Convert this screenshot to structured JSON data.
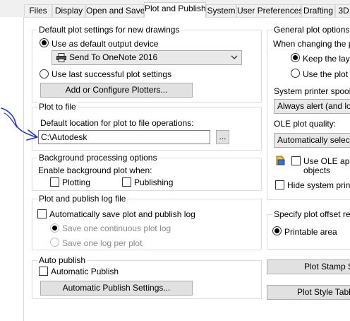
{
  "tabs": [
    "Files",
    "Display",
    "Open and Save",
    "Plot and Publish",
    "System",
    "User Preferences",
    "Drafting",
    "3D"
  ],
  "left": {
    "default_plot": {
      "title": "Default plot settings for new drawings",
      "use_default_device": "Use as default output device",
      "device_value": "Send To OneNote 2016",
      "use_last_successful": "Use last successful plot settings",
      "add_configure_plotters": "Add or Configure Plotters..."
    },
    "plot_to_file": {
      "title": "Plot to file",
      "location_label": "Default location for plot to file operations:",
      "location_value": "C:\\Autodesk",
      "browse_label": "..."
    },
    "background": {
      "title": "Background processing options",
      "enable_label": "Enable background plot when:",
      "plotting": "Plotting",
      "publishing": "Publishing"
    },
    "log_file": {
      "title": "Plot and publish log file",
      "auto_save": "Automatically save plot and publish log",
      "one_continuous": "Save one continuous plot log",
      "one_per_plot": "Save one log per plot"
    },
    "auto_publish": {
      "title": "Auto publish",
      "automatic_publish": "Automatic Publish",
      "settings_button": "Automatic Publish Settings..."
    }
  },
  "right": {
    "general": {
      "title": "General plot options",
      "changing_label": "When changing the plo",
      "keep_layout": "Keep the layou",
      "use_plot_d": "Use the plot d",
      "spool_label": "System printer spool ale",
      "spool_value": "Always alert (and log e",
      "ole_quality_label": "OLE plot quality:",
      "ole_quality_value": "Automatically select",
      "use_ole_app_line1": "Use OLE appl",
      "use_ole_app_line2": "objects",
      "hide_system_printer": "Hide system printer"
    },
    "offset": {
      "title": "Specify plot offset relati",
      "printable_area": "Printable area"
    },
    "plot_stamp_button": "Plot Stamp Se",
    "plot_style_button": "Plot Style Table"
  },
  "colors": {
    "annotation_arrow": "#2233cc",
    "checked_radio_dot": "#000000"
  },
  "icons": {
    "printer": "printer-icon",
    "dropdown": "chevron-down-icon",
    "ole_app": "ole-application-icon",
    "annotation": "hand-drawn-arrow"
  }
}
